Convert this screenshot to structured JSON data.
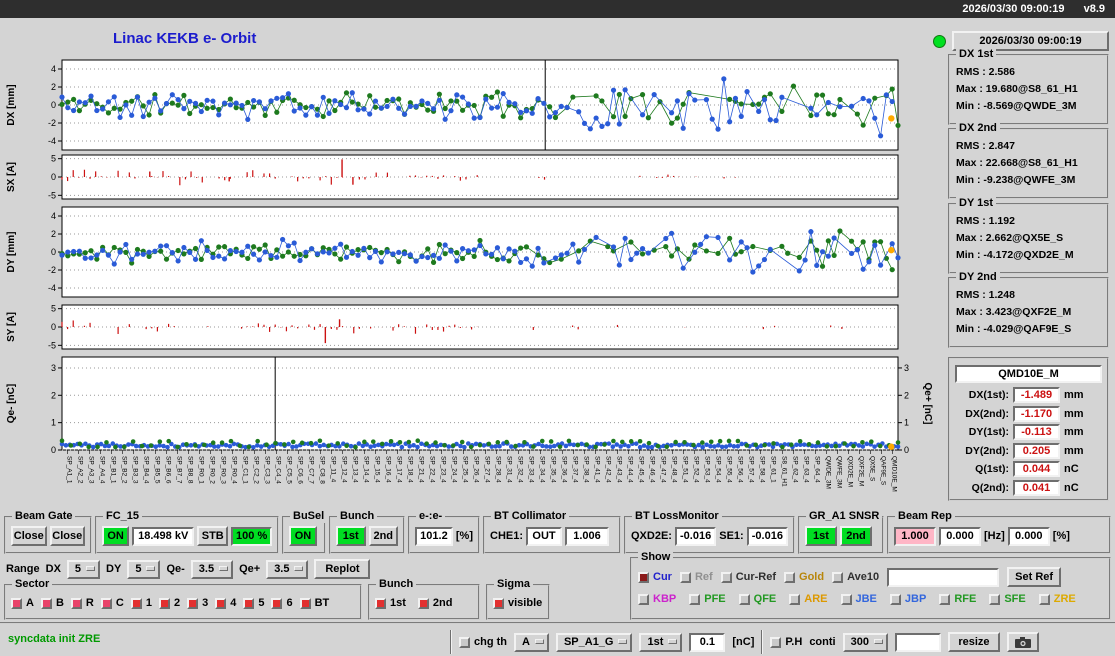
{
  "colors": {
    "title_blue": "#1c1ccd",
    "on_green": "#00dd22",
    "status_green": "#00e020",
    "pink": "#ffb6c6",
    "value_red": "#cc1111",
    "message_green": "#009900"
  },
  "titlebar": {
    "datetime": "2026/03/30 09:00:19",
    "version": "v8.9"
  },
  "header": {
    "title": "Linac KEKB e- Orbit",
    "timestamp": "2026/03/30 09:00:19"
  },
  "stats_groups": [
    {
      "title": "DX 1st",
      "lines": [
        "RMS : 2.586",
        "Max : 19.680@S8_61_H1",
        "Min : -8.569@QWDE_3M"
      ]
    },
    {
      "title": "DX 2nd",
      "lines": [
        "RMS : 2.847",
        "Max : 22.668@S8_61_H1",
        "Min : -9.238@QWFE_3M"
      ]
    },
    {
      "title": "DY 1st",
      "lines": [
        "RMS : 1.192",
        "Max : 2.662@QX5E_S",
        "Min : -4.172@QXD2E_M"
      ]
    },
    {
      "title": "DY 2nd",
      "lines": [
        "RMS : 1.248",
        "Max : 3.423@QXF2E_M",
        "Min : -4.029@QAF9E_S"
      ]
    }
  ],
  "monitor": {
    "title": "QMD10E_M",
    "rows": [
      {
        "label": "DX(1st):",
        "value": "-1.489",
        "unit": "mm"
      },
      {
        "label": "DX(2nd):",
        "value": "-1.170",
        "unit": "mm"
      },
      {
        "label": "DY(1st):",
        "value": "-0.113",
        "unit": "mm"
      },
      {
        "label": "DY(2nd):",
        "value": "0.205",
        "unit": "mm"
      },
      {
        "label": "Q(1st):",
        "value": "0.044",
        "unit": "nC"
      },
      {
        "label": "Q(2nd):",
        "value": "0.041",
        "unit": "nC"
      }
    ]
  },
  "chart_data": [
    {
      "type": "scatter",
      "title": "DX [mm]",
      "ylim": [
        -5,
        5
      ],
      "yticks": [
        4,
        2,
        0,
        -2,
        -4
      ],
      "vline": 0.578,
      "series": [
        {
          "name": "2nd bunch",
          "color": "#1e7a1e",
          "seed": 11,
          "n": 145,
          "amp": 1.6
        },
        {
          "name": "1st bunch",
          "color": "#2a5bd7",
          "seed": 5,
          "n": 145,
          "amp": 1.9
        }
      ],
      "highlight": {
        "x": 0.992,
        "y": -1.489,
        "color": "#ffaa00"
      }
    },
    {
      "type": "bar",
      "title": "SX [A]",
      "ylim": [
        -6,
        6
      ],
      "yticks": [
        5,
        0,
        -5
      ],
      "color": "#cc1111",
      "seed": 23,
      "n": 150,
      "spikes": [
        {
          "x": 0.335,
          "y": 4.8
        },
        {
          "x": 0.348,
          "y": -2.1
        },
        {
          "x": 0.105,
          "y": 1.5
        },
        {
          "x": 0.2,
          "y": -1.2
        }
      ]
    },
    {
      "type": "scatter",
      "title": "DY [mm]",
      "ylim": [
        -5,
        5
      ],
      "yticks": [
        4,
        2,
        0,
        -2,
        -4
      ],
      "series": [
        {
          "name": "2nd bunch",
          "color": "#1e7a1e",
          "seed": 17,
          "n": 145,
          "amp": 1.4
        },
        {
          "name": "1st bunch",
          "color": "#2a5bd7",
          "seed": 8,
          "n": 145,
          "amp": 1.6
        }
      ],
      "highlight": {
        "x": 0.992,
        "y": 0.205,
        "color": "#ffaa00"
      }
    },
    {
      "type": "bar",
      "title": "SY [A]",
      "ylim": [
        -6,
        6
      ],
      "yticks": [
        5,
        0,
        -5
      ],
      "color": "#cc1111",
      "seed": 31,
      "n": 150,
      "spikes": [
        {
          "x": 0.315,
          "y": -4.4
        },
        {
          "x": 0.332,
          "y": 2.1
        }
      ]
    },
    {
      "type": "charge",
      "title": "Qe- [nC]",
      "title_right": "Qe+ [nC]",
      "ylim": [
        0,
        3.4
      ],
      "yticks": [
        3,
        2,
        1,
        0
      ],
      "right_ticks": true,
      "vline": 0.255,
      "series": [
        {
          "name": "e- 1st",
          "color": "#2a5bd7",
          "seed": 41,
          "n": 215,
          "base": 0.17,
          "amp": 0.07
        },
        {
          "name": "e- 2nd",
          "color": "#1e7a1e",
          "seed": 43,
          "n": 95,
          "base": 0.22,
          "amp": 0.12
        }
      ],
      "highlight": {
        "x": 0.992,
        "y": 0.12,
        "color": "#ffaa00"
      }
    }
  ],
  "xaxis_labels": [
    "SP_A1_1",
    "SP_A2_2",
    "SP_A3_3",
    "SP_A4_4",
    "SP_B1_1",
    "SP_B2_2",
    "SP_B3_3",
    "SP_B4_4",
    "SP_B5_5",
    "SP_B6_6",
    "SP_B7_7",
    "SP_B8_8",
    "SP_R0_1",
    "SP_R0_2",
    "SP_R0_3",
    "SP_R0_4",
    "SP_C1_1",
    "SP_C2_2",
    "SP_C3_3",
    "SP_C4_4",
    "SP_C5_5",
    "SP_C6_6",
    "SP_C7_7",
    "SP_C8_8",
    "SP_11_4",
    "SP_12_4",
    "SP_13_4",
    "SP_14_4",
    "SP_15_4",
    "SP_16_4",
    "SP_17_4",
    "SP_18_4",
    "SP_21_4",
    "SP_22_4",
    "SP_23_4",
    "SP_24_4",
    "SP_25_4",
    "SP_26_4",
    "SP_27_4",
    "SP_28_4",
    "SP_31_4",
    "SP_32_4",
    "SP_33_4",
    "SP_34_4",
    "SP_35_4",
    "SP_36_4",
    "SP_37_4",
    "SP_38_4",
    "SP_41_4",
    "SP_42_4",
    "SP_43_4",
    "SP_44_4",
    "SP_45_4",
    "SP_46_4",
    "SP_47_4",
    "SP_48_4",
    "SP_51_4",
    "SP_52_4",
    "SP_53_4",
    "SP_54_4",
    "SP_55_4",
    "SP_56_4",
    "SP_57_4",
    "SP_58_4",
    "SP_61_1",
    "S8_61_H1",
    "SP_62_4",
    "SP_63_4",
    "SP_64_4",
    "QWDE_3M",
    "QWFE_3M",
    "QXD2E_M",
    "QXF2E_M",
    "QX5E_S",
    "QAF9E_S",
    "QMD10E_M"
  ],
  "controls": {
    "beam_gate": {
      "title": "Beam Gate",
      "close1": "Close",
      "close2": "Close"
    },
    "fc15": {
      "title": "FC_15",
      "on": "ON",
      "kv": "18.498 kV",
      "stb": "STB",
      "pct": "100 %"
    },
    "busel": {
      "title": "BuSel",
      "on": "ON"
    },
    "bunch_sel": {
      "title": "Bunch",
      "first": "1st",
      "second": "2nd"
    },
    "ee": {
      "title": "e-:e-",
      "value": "101.2",
      "unit": "[%]"
    },
    "bt_collimator": {
      "title": "BT Collimator",
      "che1_label": "CHE1:",
      "che1_value": "OUT",
      "extra_value": "1.006"
    },
    "bt_lossmonitor": {
      "title": "BT LossMonitor",
      "qxd2e_label": "QXD2E:",
      "qxd2e_value": "-0.016",
      "se1_label": "SE1:",
      "se1_value": "-0.016"
    },
    "gr_snsr": {
      "title": "GR_A1 SNSR",
      "first": "1st",
      "second": "2nd"
    },
    "beam_rep": {
      "title": "Beam Rep",
      "v1": "1.000",
      "v2": "0.000",
      "hz": "[Hz]",
      "v3": "0.000",
      "pct": "[%]"
    },
    "range": {
      "label": "Range",
      "dx_label": "DX",
      "dx_value": "5",
      "dy_label": "DY",
      "dy_value": "5",
      "qem_label": "Qe-",
      "qem_value": "3.5",
      "qep_label": "Qe+",
      "qep_value": "3.5",
      "replot": "Replot"
    },
    "sector": {
      "title": "Sector",
      "items": [
        {
          "label": "A",
          "box": "#e8436a"
        },
        {
          "label": "B",
          "box": "#e8436a"
        },
        {
          "label": "R",
          "box": "#e8436a"
        },
        {
          "label": "C",
          "box": "#e8436a"
        },
        {
          "label": "1",
          "box": "#e23030"
        },
        {
          "label": "2",
          "box": "#e23030"
        },
        {
          "label": "3",
          "box": "#e23030"
        },
        {
          "label": "4",
          "box": "#e23030"
        },
        {
          "label": "5",
          "box": "#e23030"
        },
        {
          "label": "6",
          "box": "#e23030"
        },
        {
          "label": "BT",
          "box": "#e23030"
        }
      ]
    },
    "bunch2": {
      "title": "Bunch",
      "items": [
        {
          "label": "1st",
          "box": "#e23030"
        },
        {
          "label": "2nd",
          "box": "#e23030"
        }
      ]
    },
    "sigma": {
      "title": "Sigma",
      "items": [
        {
          "label": "visible",
          "box": "#e23030"
        }
      ]
    },
    "show": {
      "title": "Show",
      "row1": [
        {
          "label": "Cur",
          "fg": "#2222cc",
          "box": "#8b1a1a"
        },
        {
          "label": "Ref",
          "fg": "#909090"
        },
        {
          "label": "Cur-Ref",
          "fg": "#303030"
        },
        {
          "label": "Gold",
          "fg": "#b8860b"
        },
        {
          "label": "Ave10",
          "fg": "#303030"
        }
      ],
      "ref_entry": "",
      "set_ref": "Set Ref",
      "row2": [
        {
          "label": "KBP",
          "fg": "#cc22cc"
        },
        {
          "label": "PFE",
          "fg": "#229922"
        },
        {
          "label": "QFE",
          "fg": "#229922"
        },
        {
          "label": "ARE",
          "fg": "#dd9900"
        },
        {
          "label": "JBE",
          "fg": "#3366dd"
        },
        {
          "label": "JBP",
          "fg": "#3366dd"
        },
        {
          "label": "RFE",
          "fg": "#229922"
        },
        {
          "label": "SFE",
          "fg": "#229922"
        },
        {
          "label": "ZRE",
          "fg": "#ddaa00"
        }
      ]
    },
    "statusbar": {
      "message": "syncdata init ZRE",
      "chg_th": "chg th",
      "mode": "A",
      "monitor_sel": "SP_A1_G",
      "bunch": "1st",
      "threshold": "0.1",
      "unit": "[nC]",
      "ph": "P.H",
      "conti": "conti",
      "points": "300",
      "resize": "resize"
    }
  }
}
